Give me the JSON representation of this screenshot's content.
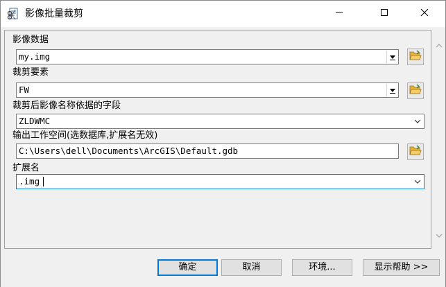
{
  "window": {
    "title": "影像批量裁剪",
    "icons": {
      "app": "scissors-document-icon",
      "minimize": "minimize-icon",
      "maximize": "maximize-icon",
      "close": "close-icon"
    }
  },
  "form": {
    "image_data": {
      "label": "影像数据",
      "value": "my.img"
    },
    "clip_features": {
      "label": "裁剪要素",
      "value": "FW"
    },
    "name_field": {
      "label": "裁剪后影像名称依据的字段",
      "value": "ZLDWMC"
    },
    "output_workspace": {
      "label": "输出工作空间(选数据库,扩展名无效)",
      "value": "C:\\Users\\dell\\Documents\\ArcGIS\\Default.gdb"
    },
    "extension": {
      "label": "扩展名",
      "value": ".img"
    }
  },
  "buttons": {
    "ok": "确定",
    "cancel": "取消",
    "environments": "环境...",
    "show_help": "显示帮助 >>"
  },
  "colors": {
    "accent": "#0078d7",
    "folder": "#e8b53c"
  }
}
